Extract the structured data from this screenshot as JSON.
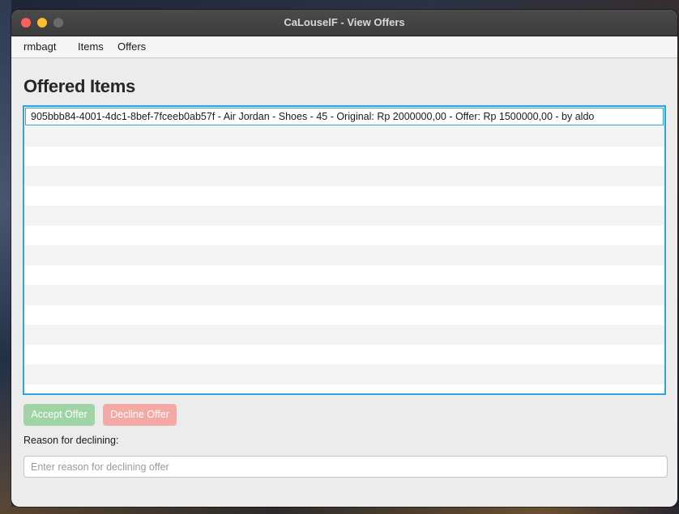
{
  "window": {
    "title": "CaLouselF - View Offers"
  },
  "menu": {
    "items": [
      "rmbagt",
      "Items",
      "Offers"
    ]
  },
  "main": {
    "heading": "Offered Items",
    "offers": [
      "905bbb84-4001-4dc1-8bef-7fceeb0ab57f - Air Jordan - Shoes - 45 - Original: Rp 2000000,00 - Offer: Rp 1500000,00 - by aldo"
    ],
    "accept_label": "Accept Offer",
    "decline_label": "Decline Offer",
    "reason_label": "Reason for declining:",
    "reason_placeholder": "Enter reason for declining offer",
    "reason_value": ""
  },
  "colors": {
    "list_border": "#2ba6dd",
    "accept_button": "#9fd4a5",
    "decline_button": "#f4a9a5"
  }
}
